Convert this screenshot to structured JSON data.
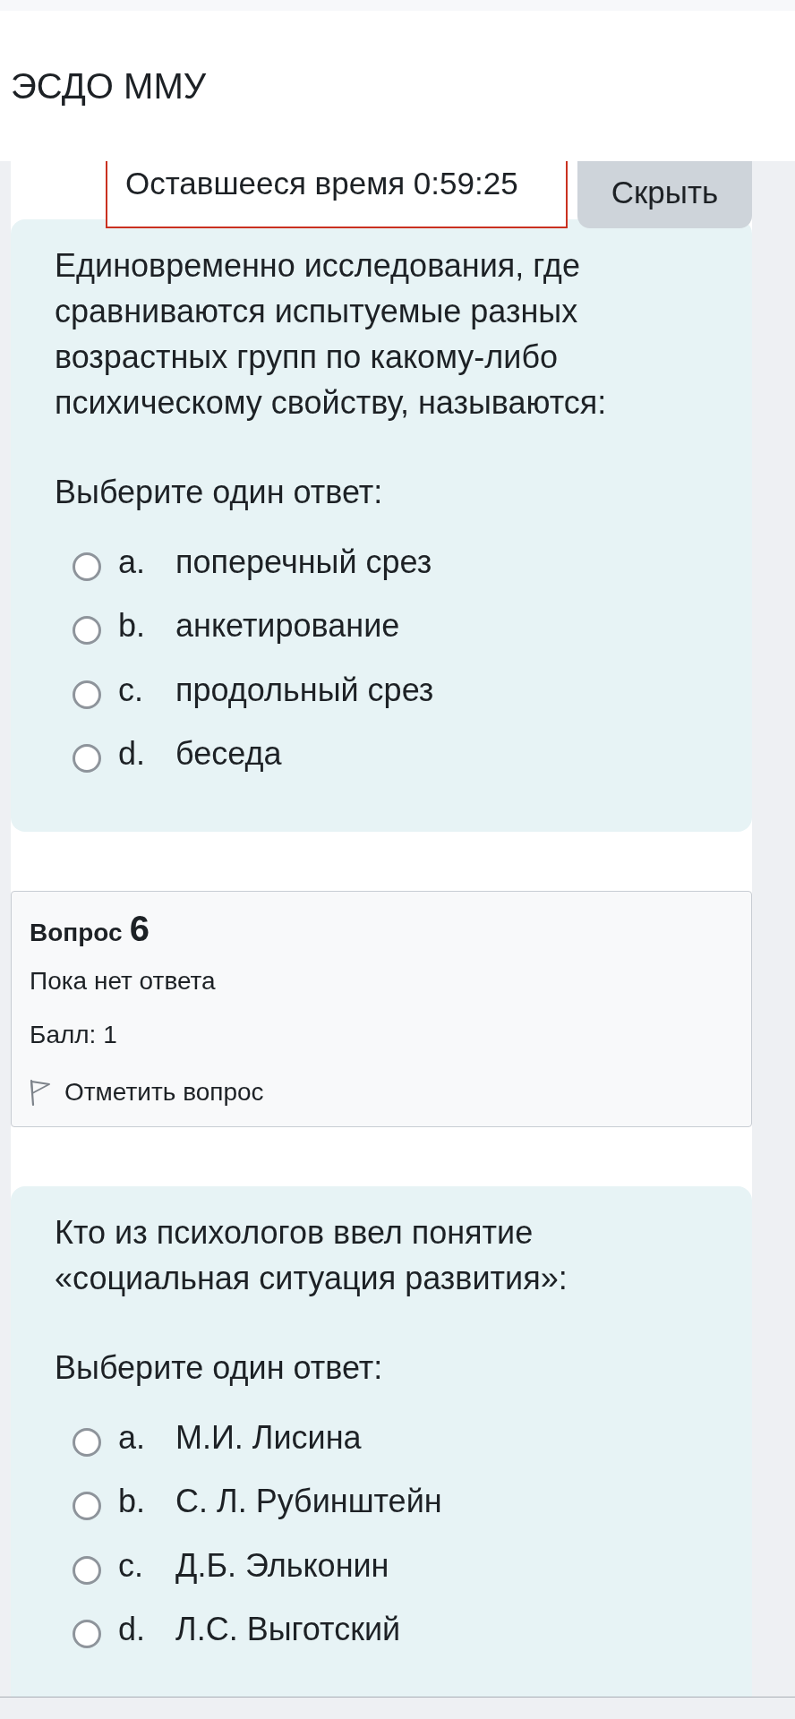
{
  "header": {
    "title": "ЭСДО ММУ"
  },
  "timer": {
    "label": "Оставшееся время 0:59:25",
    "hide_button": "Скрыть"
  },
  "blocks": [
    {
      "kind": "answer_card",
      "question": "Единовременно исследования, где сравниваются испытуемые разных возрастных групп по какому-либо психическому свойству, называются:",
      "prompt": "Выберите один ответ:",
      "options": [
        {
          "letter": "a.",
          "text": "поперечный срез",
          "selected": false
        },
        {
          "letter": "b.",
          "text": "анкетирование",
          "selected": false
        },
        {
          "letter": "c.",
          "text": "продольный срез",
          "selected": false
        },
        {
          "letter": "d.",
          "text": "беседа",
          "selected": false
        }
      ]
    },
    {
      "kind": "info",
      "label": "Вопрос",
      "number": "6",
      "status": "Пока нет ответа",
      "score": "Балл: 1",
      "flag": {
        "label": "Отметить вопрос",
        "flagged": false
      }
    },
    {
      "kind": "answer_card",
      "question": "Кто из психологов ввел понятие «социальная ситуация развития»:",
      "prompt": "Выберите один ответ:",
      "options": [
        {
          "letter": "a.",
          "text": "М.И. Лисина",
          "selected": false
        },
        {
          "letter": "b.",
          "text": "С. Л. Рубинштейн",
          "selected": false
        },
        {
          "letter": "c.",
          "text": "Д.Б. Эльконин",
          "selected": false
        },
        {
          "letter": "d.",
          "text": "Л.С. Выготский",
          "selected": false
        }
      ]
    }
  ]
}
